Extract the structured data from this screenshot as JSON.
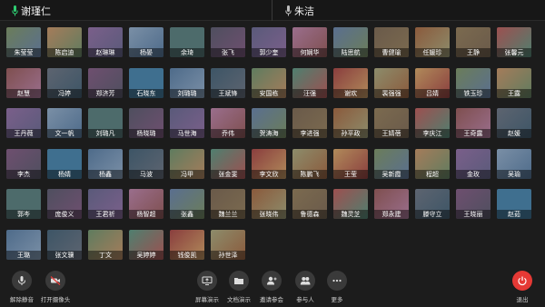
{
  "speakers": {
    "left": "谢瑾仁",
    "right": "朱洁"
  },
  "participants": [
    "朱莹莹",
    "陈启迪",
    "赵琳琳",
    "杨晏",
    "余琦",
    "张飞",
    "郭少奎",
    "何娴华",
    "陆思航",
    "曹健瑜",
    "任媛珍",
    "王静",
    "张馨元",
    "赵慧",
    "冯婷",
    "郑济芳",
    "石晓东",
    "刘璐璐",
    "王斌锋",
    "安国栋",
    "汪强",
    "谢欢",
    "裴强强",
    "吕婧",
    "铁玉珍",
    "王露",
    "王丹薇",
    "文一帆",
    "刘璐凡",
    "杨晓璐",
    "马世海",
    "乔伟",
    "贺涛海",
    "李进强",
    "孙平政",
    "王婧蓓",
    "李庆江",
    "王奇露",
    "赵媛",
    "李杰",
    "杨婧",
    "杨鑫",
    "马波",
    "冯甲",
    "张金斐",
    "李文欣",
    "陈鹏飞",
    "王莹",
    "吴新霞",
    "程超",
    "金玫",
    "吴瑜",
    "郭岑",
    "庞俊义",
    "王君祈",
    "杨智超",
    "张鑫",
    "魏兰兰",
    "张晓伟",
    "鲁德森",
    "魏灵芝",
    "郑永建",
    "滕守立",
    "王晓丽",
    "赵茹",
    "王璐",
    "张文骥",
    "丁文",
    "吴婷婷",
    "钱俊凯",
    "孙世泽"
  ],
  "toolbar": {
    "unmute": "解除静音",
    "camera": "打开摄像头",
    "share": "屏幕演示",
    "doc": "文档演示",
    "invite": "邀请参会",
    "members": "参与人",
    "more": "更多",
    "leave": "退出"
  },
  "colors": {
    "background": "#1c1c1c",
    "mic_green": "#2ecc71",
    "leave_red": "#e53935"
  }
}
